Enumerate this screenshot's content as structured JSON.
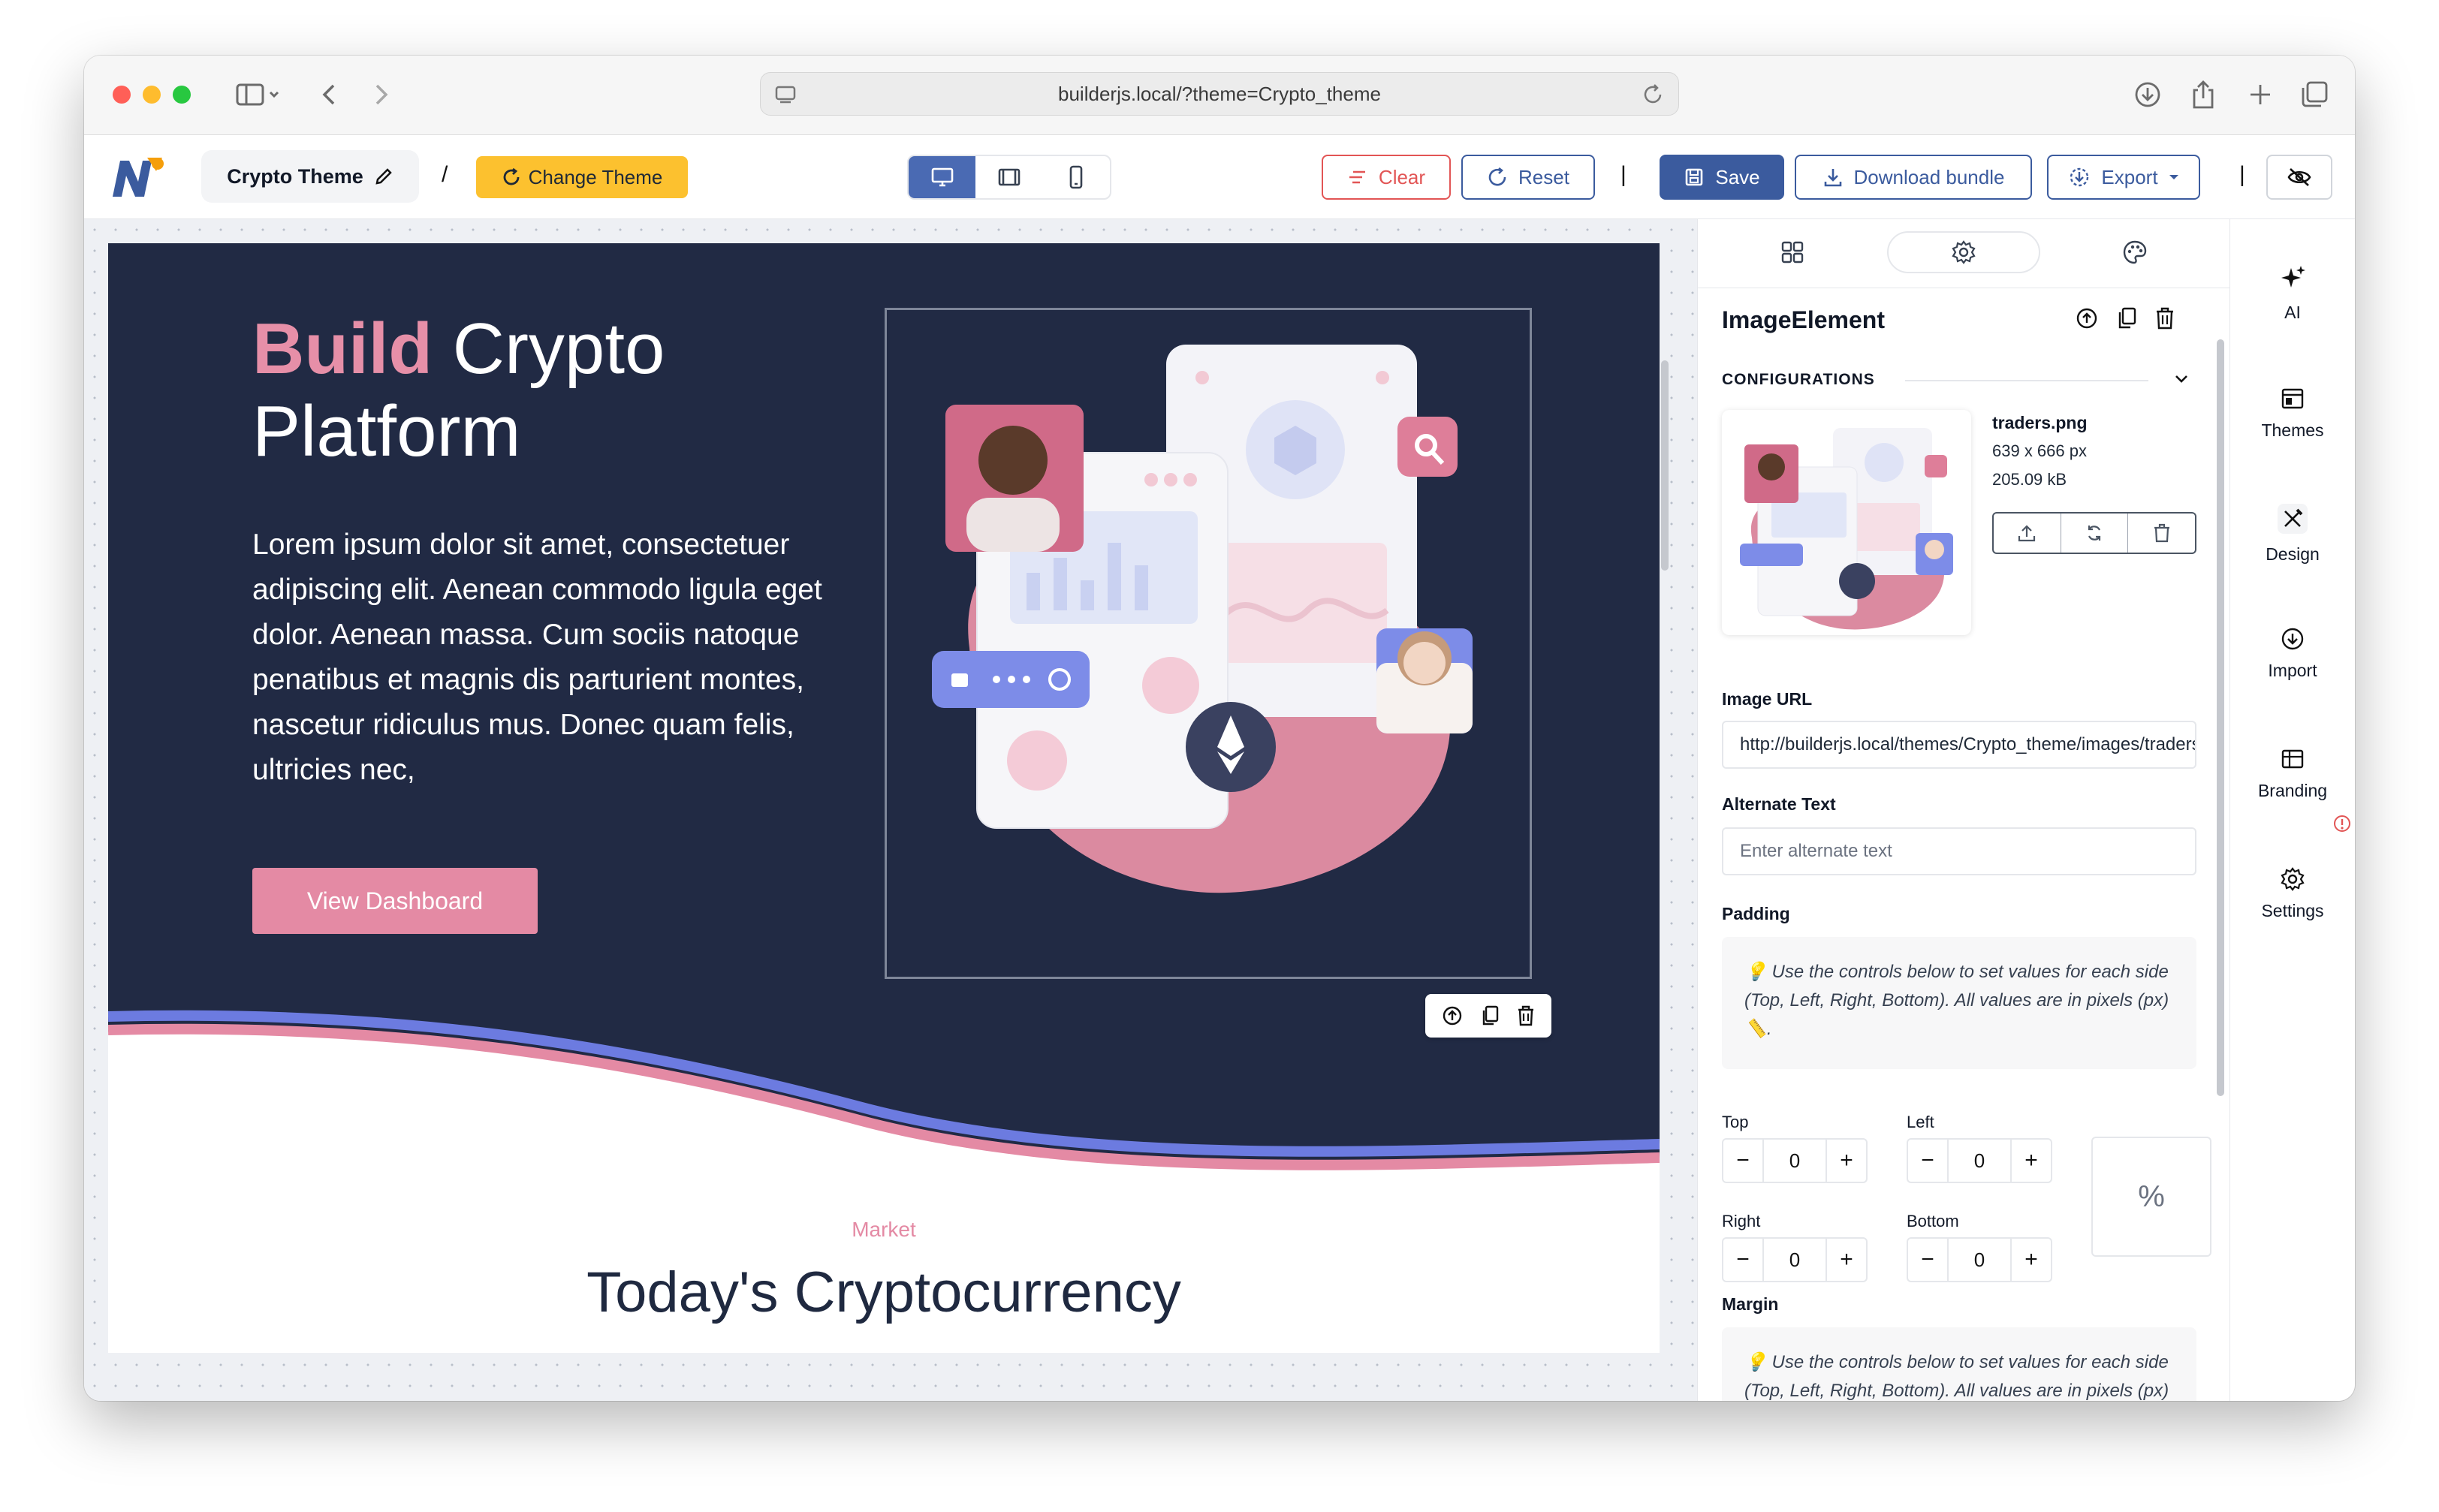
{
  "browser": {
    "url": "builderjs.local/?theme=Crypto_theme"
  },
  "toolbar": {
    "theme_name": "Crypto Theme",
    "separator": "/",
    "separator2": "|",
    "change_theme": "Change Theme",
    "clear": "Clear",
    "reset": "Reset",
    "save": "Save",
    "download_bundle": "Download bundle",
    "export": "Export"
  },
  "hero": {
    "title_accent": "Build",
    "title_rest": " Crypto Platform",
    "body": "Lorem ipsum dolor sit amet, consectetuer adipiscing elit. Aenean commodo ligula eget dolor. Aenean massa. Cum sociis natoque penatibus et magnis dis parturient montes, nascetur ridiculus mus. Donec quam felis, ultricies nec,",
    "button": "View Dashboard"
  },
  "market": {
    "label": "Market",
    "title": "Today's Cryptocurrency"
  },
  "panel": {
    "element_title": "ImageElement",
    "configurations_label": "CONFIGURATIONS",
    "file": {
      "name": "traders.png",
      "dimensions": "639 x 666 px",
      "size": "205.09 kB"
    },
    "image_url_label": "Image URL",
    "image_url_value": "http://builderjs.local/themes/Crypto_theme/images/traders.png",
    "alt_label": "Alternate Text",
    "alt_placeholder": "Enter alternate text",
    "padding_label": "Padding",
    "padding_hint": "💡 Use the controls below to set values for each side (Top, Left, Right, Bottom). All values are in pixels (px) 📏.",
    "top_label": "Top",
    "left_label": "Left",
    "right_label": "Right",
    "bottom_label": "Bottom",
    "top_value": "0",
    "left_value": "0",
    "right_value": "0",
    "bottom_value": "0",
    "unit_toggle": "%",
    "margin_label": "Margin",
    "margin_hint": "💡 Use the controls below to set values for each side (Top, Left, Right, Bottom). All values are in pixels (px) 📏."
  },
  "rail": {
    "ai": "AI",
    "themes": "Themes",
    "design": "Design",
    "import": "Import",
    "branding": "Branding",
    "settings": "Settings"
  },
  "colors": {
    "accent_pink": "#e48aa4",
    "hero_bg": "#212a44",
    "primary_blue": "#3b5b9e",
    "clear_red": "#e25555",
    "change_theme_yellow": "#fcc12f"
  }
}
